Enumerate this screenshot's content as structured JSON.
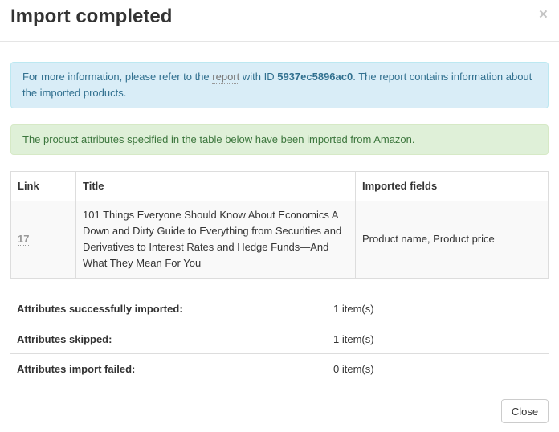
{
  "dialog": {
    "title": "Import completed",
    "close_glyph": "×"
  },
  "info_alert": {
    "text_before": "For more information, please refer to the ",
    "link_text": "report",
    "text_mid": " with ID ",
    "report_id": "5937ec5896ac0",
    "text_after": ". The report contains information about the imported products."
  },
  "success_alert": {
    "text": "The product attributes specified in the table below have been imported from Amazon."
  },
  "table": {
    "headers": {
      "link": "Link",
      "title": "Title",
      "imported_fields": "Imported fields"
    },
    "rows": [
      {
        "link": "17",
        "title": "101 Things Everyone Should Know About Economics A Down and Dirty Guide to Everything from Securities and Derivatives to Interest Rates and Hedge Funds—And What They Mean For You",
        "imported_fields": "Product name, Product price"
      }
    ]
  },
  "summary": [
    {
      "label": "Attributes successfully imported:",
      "value": "1 item(s)"
    },
    {
      "label": "Attributes skipped:",
      "value": "1 item(s)"
    },
    {
      "label": "Attributes import failed:",
      "value": "0 item(s)"
    }
  ],
  "footer": {
    "close_label": "Close"
  }
}
